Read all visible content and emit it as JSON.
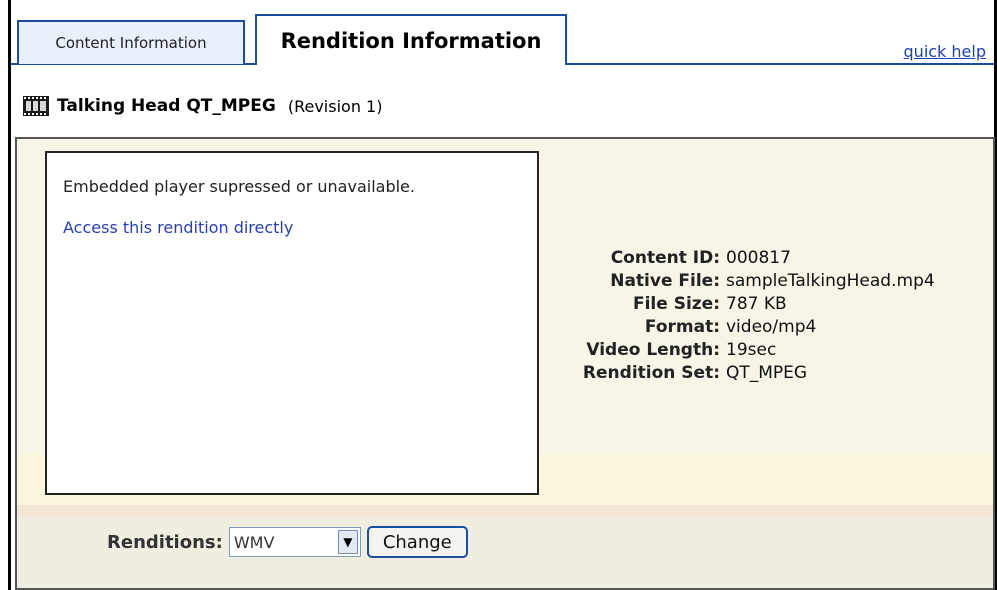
{
  "tabs": {
    "content_info": "Content Information",
    "rendition_info": "Rendition Information"
  },
  "quick_help": "quick help",
  "header": {
    "title": "Talking Head QT_MPEG",
    "revision": "(Revision 1)",
    "icon": "film-icon"
  },
  "player": {
    "message": "Embedded player supressed or unavailable.",
    "link": "Access this rendition directly"
  },
  "info": {
    "content_id_label": "Content ID:",
    "content_id": "000817",
    "native_file_label": "Native File:",
    "native_file": "sampleTalkingHead.mp4",
    "file_size_label": "File Size:",
    "file_size": "787 KB",
    "format_label": "Format:",
    "format": "video/mp4",
    "video_length_label": "Video Length:",
    "video_length": "19sec",
    "rendition_set_label": "Rendition Set:",
    "rendition_set": "QT_MPEG"
  },
  "renditions": {
    "label": "Renditions:",
    "selected": "WMV",
    "change_label": "Change"
  },
  "colors": {
    "tab_border": "#1c4ea0",
    "link": "#2a3fb5",
    "panel_bg": "#f6f5e8"
  }
}
